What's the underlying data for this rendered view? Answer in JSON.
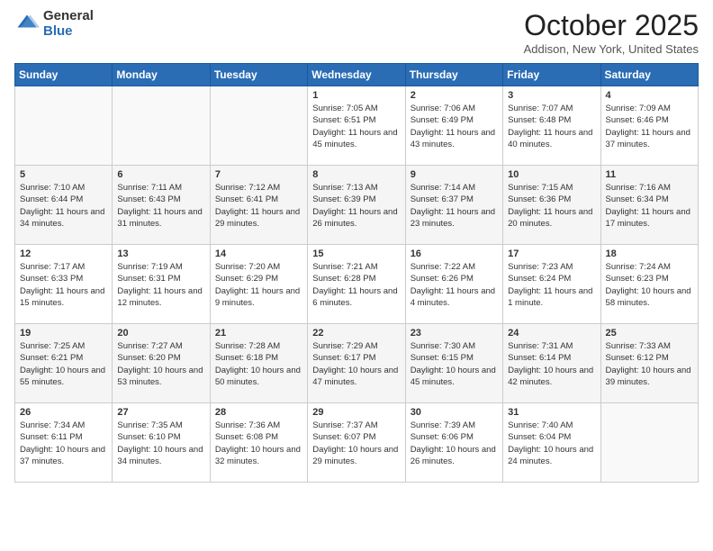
{
  "header": {
    "logo_general": "General",
    "logo_blue": "Blue",
    "month_title": "October 2025",
    "location": "Addison, New York, United States"
  },
  "days_of_week": [
    "Sunday",
    "Monday",
    "Tuesday",
    "Wednesday",
    "Thursday",
    "Friday",
    "Saturday"
  ],
  "weeks": [
    [
      {
        "day": "",
        "info": ""
      },
      {
        "day": "",
        "info": ""
      },
      {
        "day": "",
        "info": ""
      },
      {
        "day": "1",
        "info": "Sunrise: 7:05 AM\nSunset: 6:51 PM\nDaylight: 11 hours and 45 minutes."
      },
      {
        "day": "2",
        "info": "Sunrise: 7:06 AM\nSunset: 6:49 PM\nDaylight: 11 hours and 43 minutes."
      },
      {
        "day": "3",
        "info": "Sunrise: 7:07 AM\nSunset: 6:48 PM\nDaylight: 11 hours and 40 minutes."
      },
      {
        "day": "4",
        "info": "Sunrise: 7:09 AM\nSunset: 6:46 PM\nDaylight: 11 hours and 37 minutes."
      }
    ],
    [
      {
        "day": "5",
        "info": "Sunrise: 7:10 AM\nSunset: 6:44 PM\nDaylight: 11 hours and 34 minutes."
      },
      {
        "day": "6",
        "info": "Sunrise: 7:11 AM\nSunset: 6:43 PM\nDaylight: 11 hours and 31 minutes."
      },
      {
        "day": "7",
        "info": "Sunrise: 7:12 AM\nSunset: 6:41 PM\nDaylight: 11 hours and 29 minutes."
      },
      {
        "day": "8",
        "info": "Sunrise: 7:13 AM\nSunset: 6:39 PM\nDaylight: 11 hours and 26 minutes."
      },
      {
        "day": "9",
        "info": "Sunrise: 7:14 AM\nSunset: 6:37 PM\nDaylight: 11 hours and 23 minutes."
      },
      {
        "day": "10",
        "info": "Sunrise: 7:15 AM\nSunset: 6:36 PM\nDaylight: 11 hours and 20 minutes."
      },
      {
        "day": "11",
        "info": "Sunrise: 7:16 AM\nSunset: 6:34 PM\nDaylight: 11 hours and 17 minutes."
      }
    ],
    [
      {
        "day": "12",
        "info": "Sunrise: 7:17 AM\nSunset: 6:33 PM\nDaylight: 11 hours and 15 minutes."
      },
      {
        "day": "13",
        "info": "Sunrise: 7:19 AM\nSunset: 6:31 PM\nDaylight: 11 hours and 12 minutes."
      },
      {
        "day": "14",
        "info": "Sunrise: 7:20 AM\nSunset: 6:29 PM\nDaylight: 11 hours and 9 minutes."
      },
      {
        "day": "15",
        "info": "Sunrise: 7:21 AM\nSunset: 6:28 PM\nDaylight: 11 hours and 6 minutes."
      },
      {
        "day": "16",
        "info": "Sunrise: 7:22 AM\nSunset: 6:26 PM\nDaylight: 11 hours and 4 minutes."
      },
      {
        "day": "17",
        "info": "Sunrise: 7:23 AM\nSunset: 6:24 PM\nDaylight: 11 hours and 1 minute."
      },
      {
        "day": "18",
        "info": "Sunrise: 7:24 AM\nSunset: 6:23 PM\nDaylight: 10 hours and 58 minutes."
      }
    ],
    [
      {
        "day": "19",
        "info": "Sunrise: 7:25 AM\nSunset: 6:21 PM\nDaylight: 10 hours and 55 minutes."
      },
      {
        "day": "20",
        "info": "Sunrise: 7:27 AM\nSunset: 6:20 PM\nDaylight: 10 hours and 53 minutes."
      },
      {
        "day": "21",
        "info": "Sunrise: 7:28 AM\nSunset: 6:18 PM\nDaylight: 10 hours and 50 minutes."
      },
      {
        "day": "22",
        "info": "Sunrise: 7:29 AM\nSunset: 6:17 PM\nDaylight: 10 hours and 47 minutes."
      },
      {
        "day": "23",
        "info": "Sunrise: 7:30 AM\nSunset: 6:15 PM\nDaylight: 10 hours and 45 minutes."
      },
      {
        "day": "24",
        "info": "Sunrise: 7:31 AM\nSunset: 6:14 PM\nDaylight: 10 hours and 42 minutes."
      },
      {
        "day": "25",
        "info": "Sunrise: 7:33 AM\nSunset: 6:12 PM\nDaylight: 10 hours and 39 minutes."
      }
    ],
    [
      {
        "day": "26",
        "info": "Sunrise: 7:34 AM\nSunset: 6:11 PM\nDaylight: 10 hours and 37 minutes."
      },
      {
        "day": "27",
        "info": "Sunrise: 7:35 AM\nSunset: 6:10 PM\nDaylight: 10 hours and 34 minutes."
      },
      {
        "day": "28",
        "info": "Sunrise: 7:36 AM\nSunset: 6:08 PM\nDaylight: 10 hours and 32 minutes."
      },
      {
        "day": "29",
        "info": "Sunrise: 7:37 AM\nSunset: 6:07 PM\nDaylight: 10 hours and 29 minutes."
      },
      {
        "day": "30",
        "info": "Sunrise: 7:39 AM\nSunset: 6:06 PM\nDaylight: 10 hours and 26 minutes."
      },
      {
        "day": "31",
        "info": "Sunrise: 7:40 AM\nSunset: 6:04 PM\nDaylight: 10 hours and 24 minutes."
      },
      {
        "day": "",
        "info": ""
      }
    ]
  ]
}
